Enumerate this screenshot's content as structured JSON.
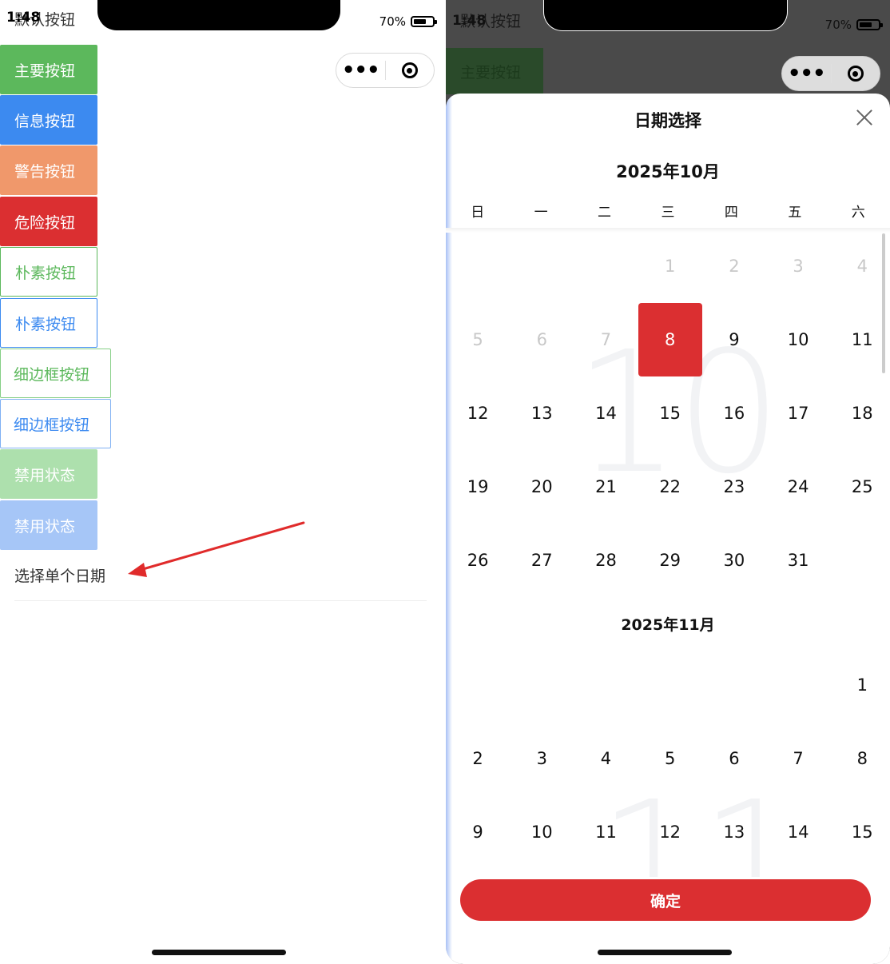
{
  "status": {
    "time": "1:48",
    "battery": "70%",
    "battery_level": 0.7
  },
  "capsule": {
    "menu": "•••"
  },
  "buttons": {
    "default": "默认按钮",
    "primary": "主要按钮",
    "info": "信息按钮",
    "warning": "警告按钮",
    "danger": "危险按钮",
    "plain_green": "朴素按钮",
    "plain_blue": "朴素按钮",
    "hairline_green": "细边框按钮",
    "hairline_blue": "细边框按钮",
    "disabled_green": "禁用状态",
    "disabled_blue": "禁用状态"
  },
  "cell": {
    "label": "选择单个日期"
  },
  "calendar": {
    "title": "日期选择",
    "weekdays": [
      "日",
      "一",
      "二",
      "三",
      "四",
      "五",
      "六"
    ],
    "month1": {
      "header": "2025年10月",
      "watermark": "10",
      "first_weekday": 3,
      "days": 31,
      "disabled_through": 7,
      "selected": 8
    },
    "month2": {
      "header": "2025年11月",
      "watermark": "11",
      "first_weekday": 6,
      "visible_days": 15
    },
    "confirm_label": "确定"
  },
  "colors": {
    "primary": "#5cb85c",
    "info": "#3c8af0",
    "warning": "#f0986b",
    "danger": "#db2f31"
  }
}
